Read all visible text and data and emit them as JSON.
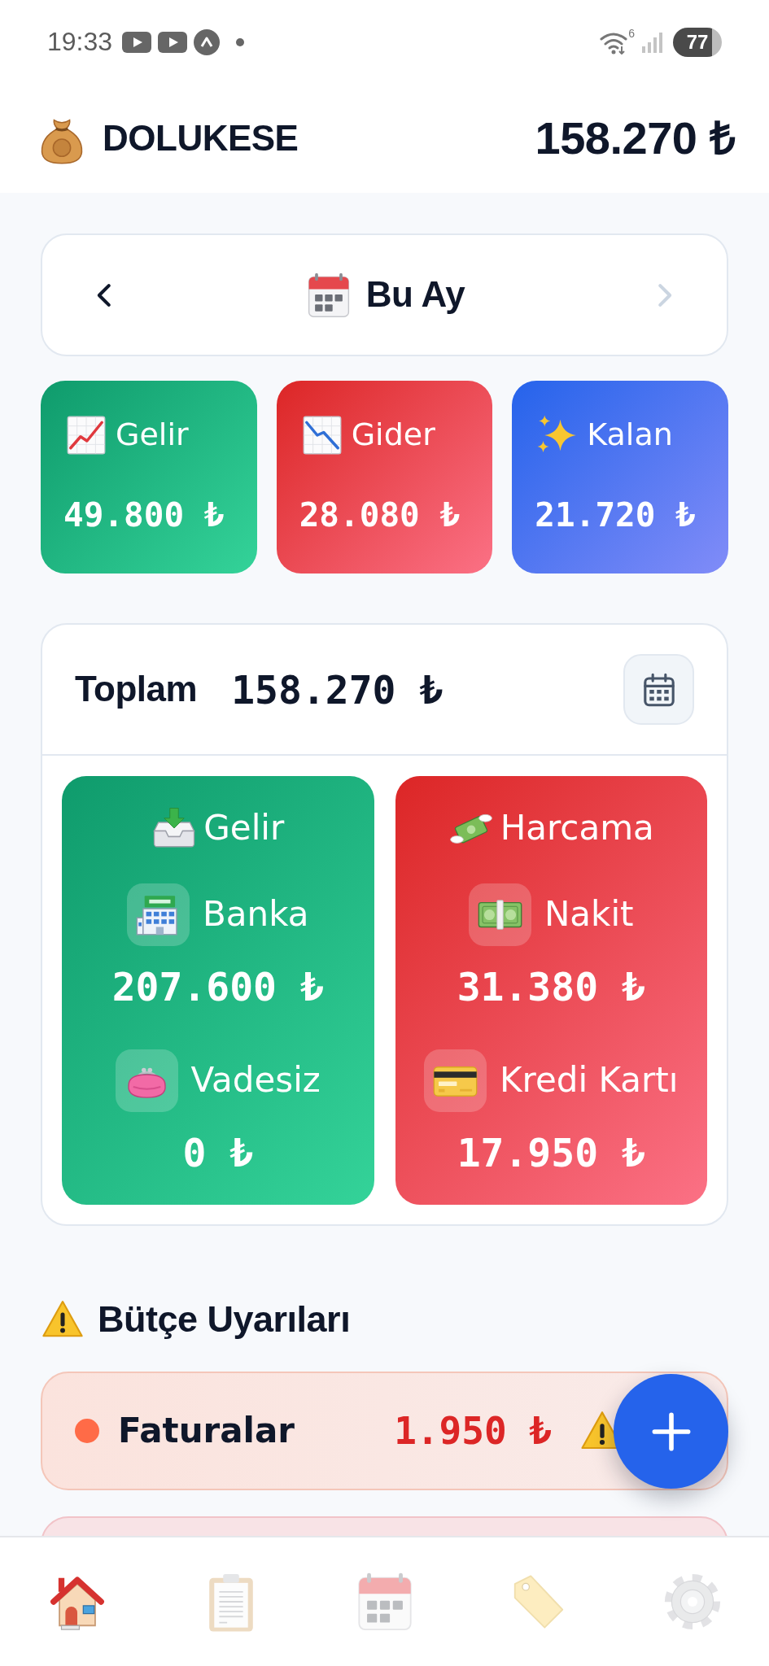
{
  "status_bar": {
    "time": "19:33",
    "wifi_label": "6",
    "battery": "77"
  },
  "header": {
    "app_name": "DOLUKESE",
    "balance": "158.270 ₺"
  },
  "period": {
    "label": "Bu Ay",
    "prev": {
      "disabled": false
    },
    "next": {
      "disabled": true
    }
  },
  "summary_cards": [
    {
      "kind": "income",
      "label": "Gelir",
      "amount": "49.800 ₺"
    },
    {
      "kind": "expense",
      "label": "Gider",
      "amount": "28.080 ₺"
    },
    {
      "kind": "balance",
      "label": "Kalan",
      "amount": "21.720 ₺"
    }
  ],
  "total": {
    "label": "Toplam",
    "amount": "158.270 ₺",
    "sections": [
      {
        "kind": "income",
        "title": "Gelir",
        "accounts": [
          {
            "name": "Banka",
            "amount": "207.600 ₺"
          },
          {
            "name": "Vadesiz",
            "amount": "0 ₺"
          }
        ]
      },
      {
        "kind": "expense",
        "title": "Harcama",
        "accounts": [
          {
            "name": "Nakit",
            "amount": "31.380 ₺"
          },
          {
            "name": "Kredi Kartı",
            "amount": "17.950 ₺"
          }
        ]
      }
    ]
  },
  "budget_alerts": {
    "title": "Bütçe Uyarıları",
    "items": [
      {
        "name": "Faturalar",
        "amount": "1.950 ₺",
        "color": "#ff6b47"
      }
    ]
  },
  "bottom_nav": [
    {
      "selected": true
    },
    {
      "selected": false
    },
    {
      "selected": false
    },
    {
      "selected": false
    },
    {
      "selected": false
    }
  ]
}
